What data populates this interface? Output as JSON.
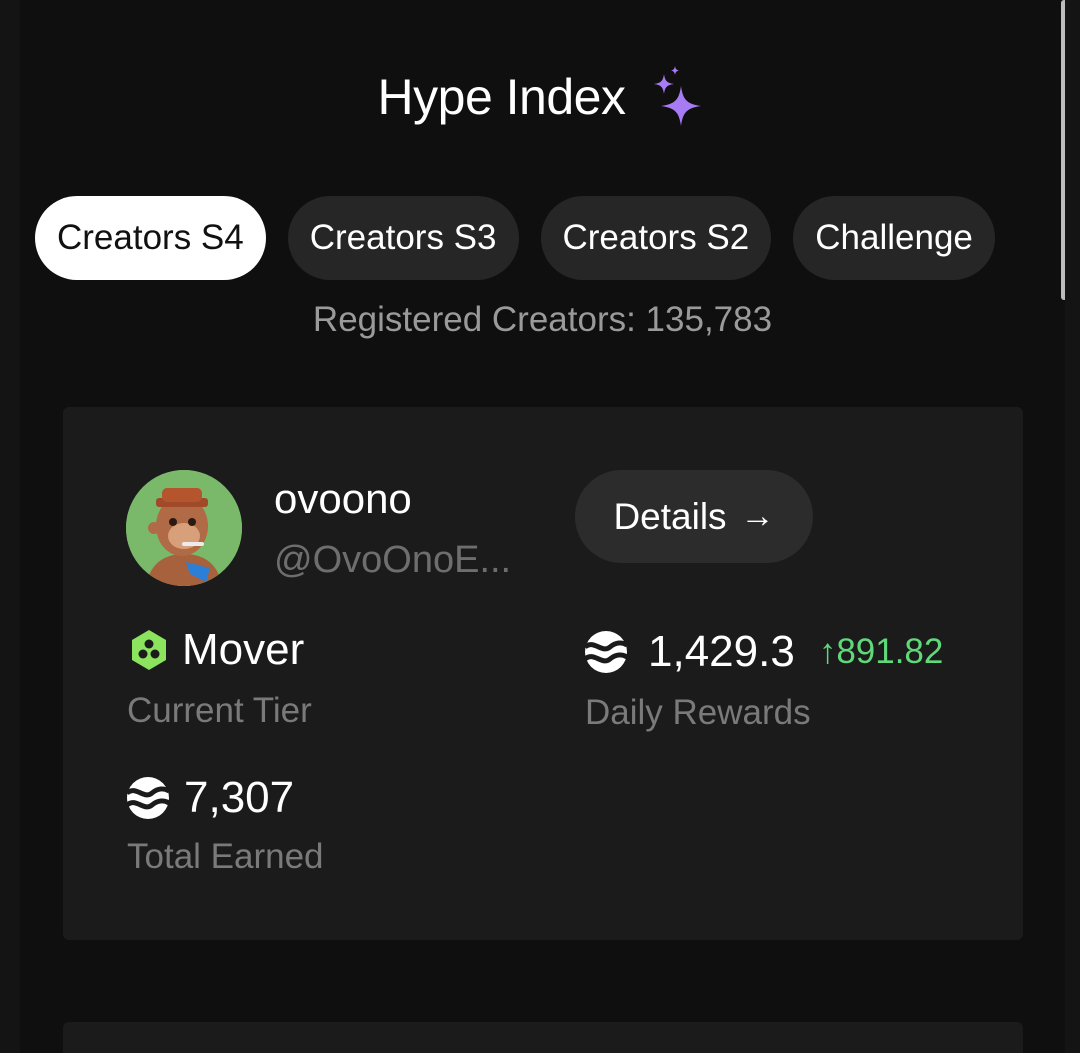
{
  "header": {
    "title": "Hype Index",
    "title_icon": "sparkle-icon",
    "accent_color": "#a77bf3"
  },
  "tabs": [
    {
      "label": "Creators S4",
      "active": true
    },
    {
      "label": "Creators S3",
      "active": false
    },
    {
      "label": "Creators S2",
      "active": false
    },
    {
      "label": "Challenge",
      "active": false
    }
  ],
  "registered_text": "Registered Creators: 135,783",
  "profile": {
    "username": "ovoono",
    "handle": "@OvoOnoE...",
    "details_label": "Details",
    "details_arrow": "→",
    "tier": {
      "name": "Mover",
      "label": "Current Tier",
      "icon": "hexagon-tier-icon",
      "color": "#8be35e"
    },
    "daily_rewards": {
      "value": "1,429.3",
      "change": "↑891.82",
      "label": "Daily Rewards",
      "icon": "wave-coin-icon",
      "change_color": "#5fd97a"
    },
    "total_earned": {
      "value": "7,307",
      "label": "Total Earned",
      "icon": "wave-coin-icon"
    }
  }
}
